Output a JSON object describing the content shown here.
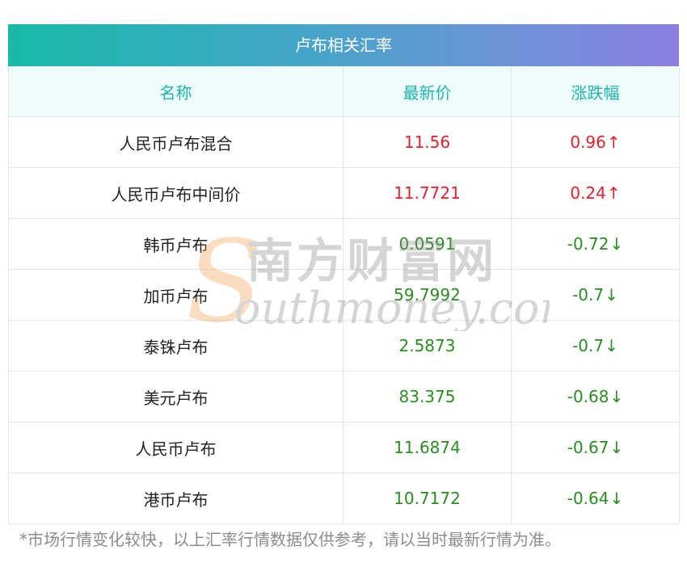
{
  "title": "卢布相关汇率",
  "columns": [
    "名称",
    "最新价",
    "涨跌幅"
  ],
  "rows": [
    {
      "name": "人民币卢布混合",
      "price": "11.56",
      "change": "0.96",
      "arrow": "↑",
      "direction": "up"
    },
    {
      "name": "人民币卢布中间价",
      "price": "11.7721",
      "change": "0.24",
      "arrow": "↑",
      "direction": "up"
    },
    {
      "name": "韩币卢布",
      "price": "0.0591",
      "change": "-0.72",
      "arrow": "↓",
      "direction": "down"
    },
    {
      "name": "加币卢布",
      "price": "59.7992",
      "change": "-0.7",
      "arrow": "↓",
      "direction": "down"
    },
    {
      "name": "泰铢卢布",
      "price": "2.5873",
      "change": "-0.7",
      "arrow": "↓",
      "direction": "down"
    },
    {
      "name": "美元卢布",
      "price": "83.375",
      "change": "-0.68",
      "arrow": "↓",
      "direction": "down"
    },
    {
      "name": "人民币卢布",
      "price": "11.6874",
      "change": "-0.67",
      "arrow": "↓",
      "direction": "down"
    },
    {
      "name": "港币卢布",
      "price": "10.7172",
      "change": "-0.64",
      "arrow": "↓",
      "direction": "down"
    }
  ],
  "footnote": "*市场行情变化较快，以上汇率行情数据仅供参考，请以当时最新行情为准。",
  "watermark": {
    "cn": "南方财富网",
    "en": "outhmoney.com",
    "logo_letter": "S"
  },
  "colors": {
    "up": "#e5212b",
    "down": "#2a8d22",
    "header_text": "#1eb5a9",
    "gradient_start": "#17b9a8",
    "gradient_end": "#8b7ee0"
  }
}
